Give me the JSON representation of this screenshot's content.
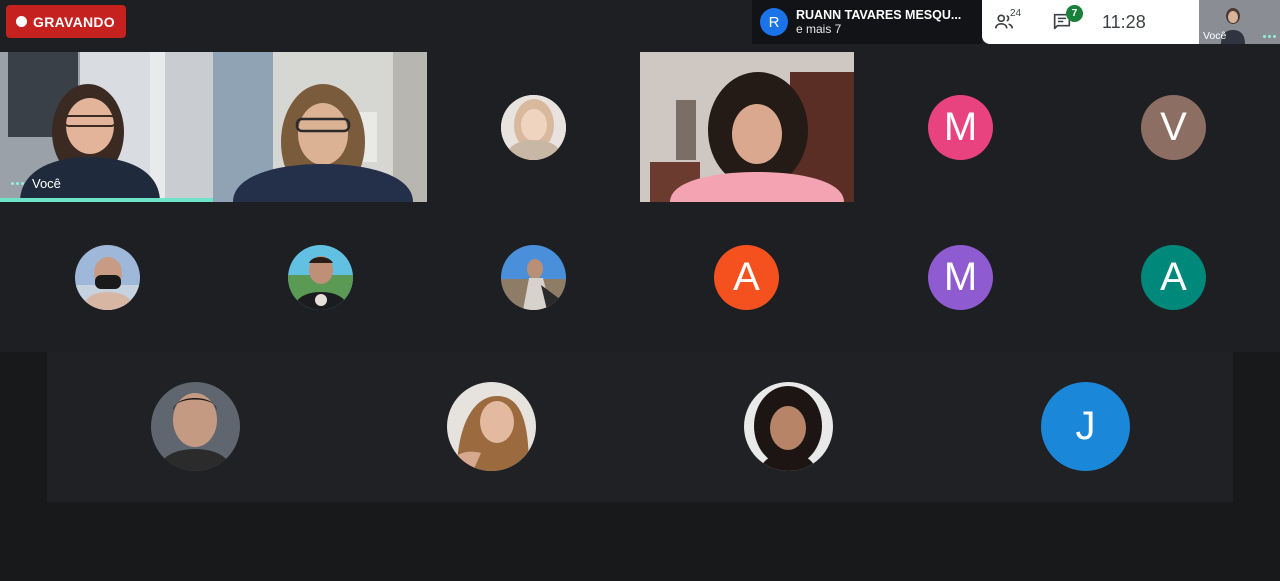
{
  "recording": {
    "label": "GRAVANDO"
  },
  "presenter": {
    "initial": "R",
    "name": "RUANN TAVARES MESQU...",
    "more": "e mais 7"
  },
  "toolbar": {
    "participants_count": "24",
    "chat_badge": "7",
    "time": "11:28"
  },
  "self_view": {
    "label": "Você"
  },
  "tiles": {
    "you_label": "Você",
    "letters": {
      "m1": "M",
      "v": "V",
      "a1": "A",
      "m2": "M",
      "a2": "A",
      "j": "J"
    }
  },
  "colors": {
    "m1": "#e8437e",
    "v": "#8d6e63",
    "a1": "#f4511e",
    "m2": "#8e5bd0",
    "a2": "#00897b",
    "j": "#1a87d8"
  },
  "icons": [
    "record-dot-icon",
    "people-icon",
    "chat-icon",
    "more-dots-icon"
  ]
}
